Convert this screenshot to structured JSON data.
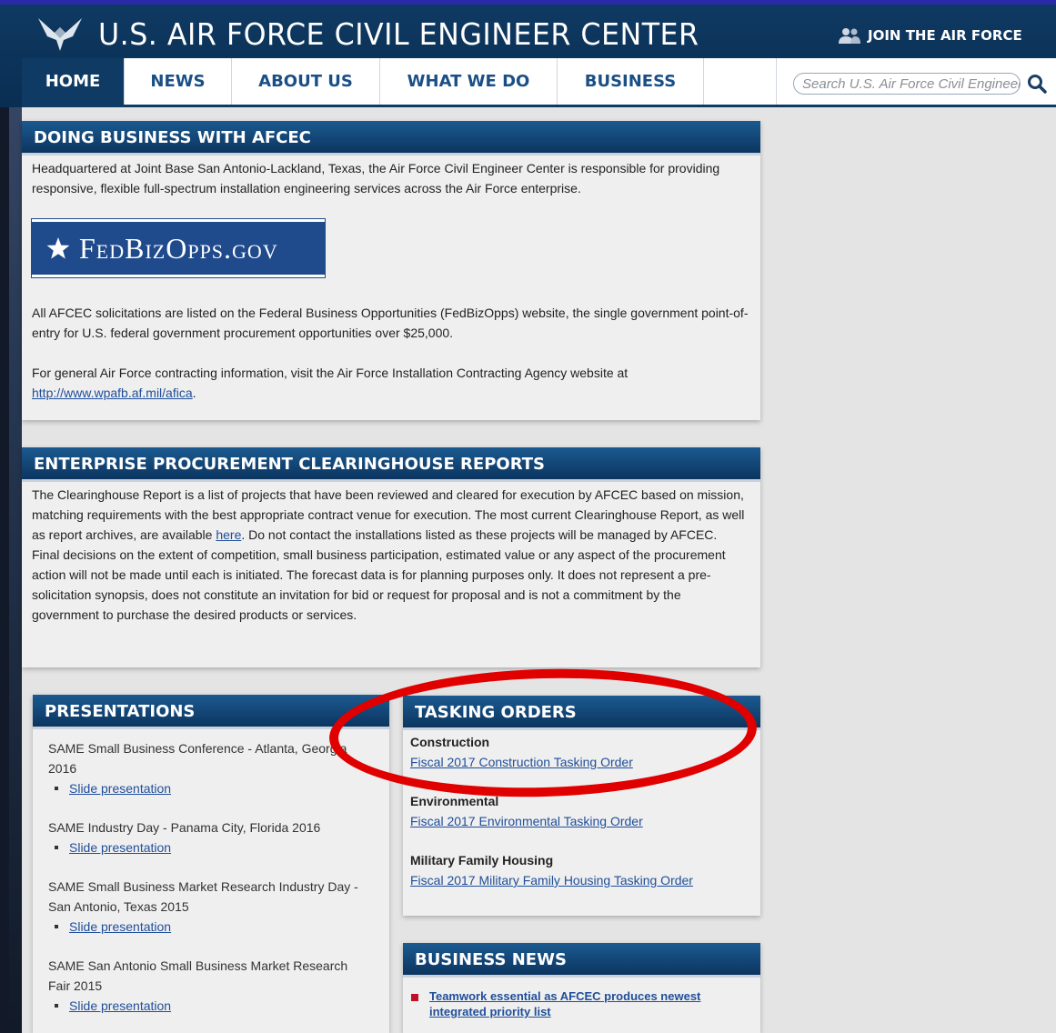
{
  "header": {
    "site_title": "U.S. AIR FORCE CIVIL ENGINEER CENTER",
    "join_label": "JOIN THE AIR FORCE",
    "search_placeholder": "Search U.S. Air Force Civil Engineer Center"
  },
  "nav": {
    "items": [
      {
        "label": "HOME",
        "active": true
      },
      {
        "label": "NEWS"
      },
      {
        "label": "ABOUT US"
      },
      {
        "label": "WHAT WE DO"
      },
      {
        "label": "BUSINESS"
      }
    ]
  },
  "doing_business": {
    "title": "DOING BUSINESS WITH AFCEC",
    "intro": "Headquartered at Joint Base San Antonio-Lackland, Texas, the Air Force Civil Engineer Center is responsible for providing responsive, flexible full-spectrum installation engineering services across the Air Force enterprise.",
    "fbo_logo_text": "FedBizOpps.gov",
    "solicitations": "All AFCEC solicitations are listed on the Federal Business Opportunities (FedBizOpps) website, the single government point-of-entry for U.S. federal government procurement opportunities over $25,000.",
    "contracting_text": "For general Air Force contracting information, visit the Air Force Installation Contracting Agency website at",
    "contracting_link": "http://www.wpafb.af.mil/afica",
    "contracting_period": "."
  },
  "clearinghouse": {
    "title": "ENTERPRISE PROCUREMENT CLEARINGHOUSE REPORTS",
    "p1_before": "The Clearinghouse Report is a list of projects that have been reviewed and cleared for execution by AFCEC based on mission, matching requirements with the best appropriate contract venue for execution. The most current Clearinghouse Report, as well as report archives, are available",
    "p1_link": "here",
    "p1_after": ". Do not contact the installations listed as these projects will be managed by AFCEC.",
    "p2": "Final decisions on the extent of competition, small business participation, estimated value or any aspect of the procurement action will not be made until each is initiated. The forecast data is for planning purposes only. It does not represent a pre-solicitation synopsis, does not constitute an invitation for bid or request for proposal and is not a commitment by the government to purchase the desired products or services."
  },
  "presentations": {
    "title": "PRESENTATIONS",
    "items": [
      {
        "title": "SAME Small Business Conference - Atlanta, Georgia 2016",
        "link": "Slide presentation"
      },
      {
        "title": "SAME Industry Day - Panama City, Florida 2016",
        "link": "Slide presentation"
      },
      {
        "title": "SAME Small Business Market Research Industry Day - San Antonio, Texas 2015",
        "link": "Slide presentation"
      },
      {
        "title": "SAME San Antonio Small Business Market Research Fair 2015",
        "link": "Slide presentation"
      }
    ]
  },
  "tasking_orders": {
    "title": "TASKING ORDERS",
    "groups": [
      {
        "label": "Construction",
        "link": "Fiscal 2017 Construction Tasking Order"
      },
      {
        "label": "Environmental",
        "link": "Fiscal 2017 Environmental Tasking Order"
      },
      {
        "label": "Military Family Housing",
        "link": "Fiscal 2017 Military Family Housing Tasking Order"
      }
    ]
  },
  "business_news": {
    "title": "BUSINESS NEWS",
    "items": [
      {
        "label": "Teamwork essential as AFCEC produces newest integrated priority list"
      }
    ]
  },
  "colors": {
    "header_bg": "#0f3a63",
    "panel_head": "#0c3560",
    "link": "#1f4e9a",
    "annotation_oval": "#e00000",
    "news_bullet": "#c0102a"
  }
}
